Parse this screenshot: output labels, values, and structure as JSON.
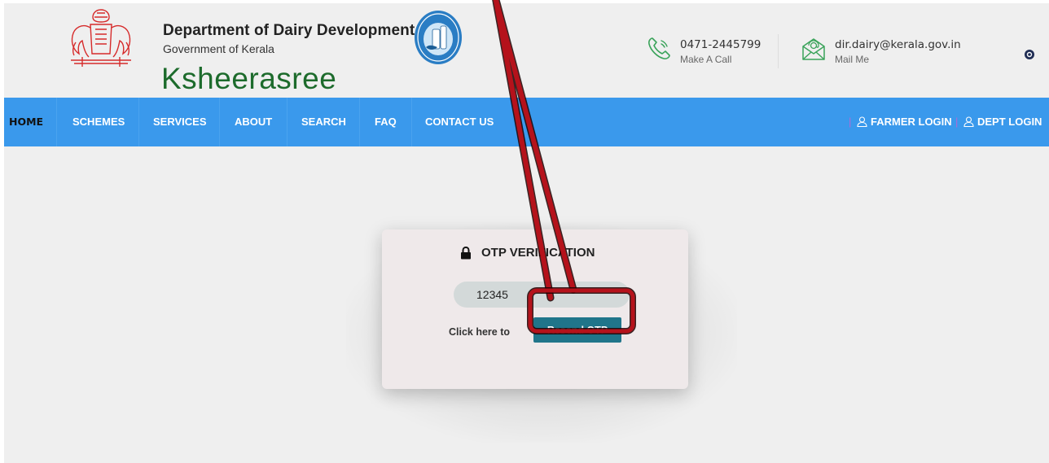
{
  "header": {
    "dept_title": "Department of Dairy Development",
    "gov_line": "Government of Kerala",
    "brand": "Ksheerasree",
    "phone": {
      "number": "0471-2445799",
      "caption": "Make A Call",
      "icon": "phone-icon"
    },
    "mail": {
      "address": "dir.dairy@kerala.gov.in",
      "caption": "Mail Me",
      "icon": "mail-icon"
    }
  },
  "nav": {
    "items": [
      "HOME",
      "SCHEMES",
      "SERVICES",
      "ABOUT",
      "SEARCH",
      "FAQ",
      "CONTACT US"
    ],
    "active": "HOME",
    "farmer_login": "FARMER LOGIN",
    "dept_login": "DEPT LOGIN",
    "pipe": "|"
  },
  "otp": {
    "title": "OTP VERIFICATION",
    "lock_icon": "lock-icon",
    "input_value": "12345",
    "click_label": "Click here to",
    "resend_label": "Resend OTP"
  },
  "colors": {
    "nav_bg": "#3a99ec",
    "brand_green": "#1d6b2c",
    "button_teal": "#20758a",
    "annotation_red": "#b5121b"
  }
}
